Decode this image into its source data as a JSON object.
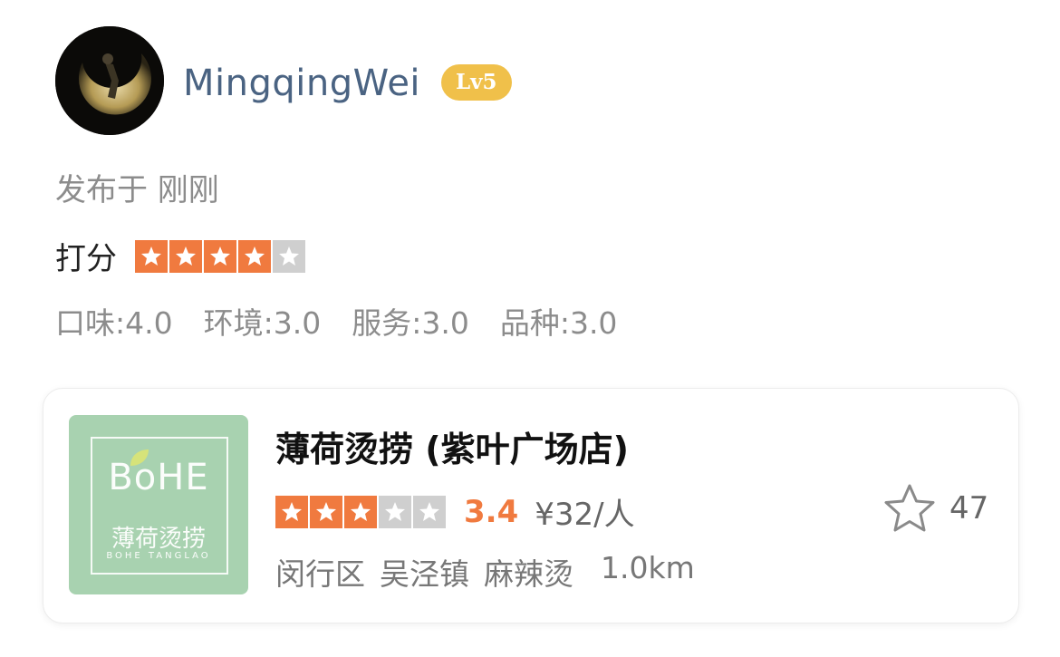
{
  "user": {
    "name": "MingqingWei",
    "level": "Lv5"
  },
  "post": {
    "published": "发布于 刚刚"
  },
  "rating": {
    "label": "打分",
    "stars": 4,
    "max_stars": 5,
    "subscores": [
      {
        "label": "口味:4.0"
      },
      {
        "label": "环境:3.0"
      },
      {
        "label": "服务:3.0"
      },
      {
        "label": "品种:3.0"
      }
    ]
  },
  "shop": {
    "name": "薄荷烫捞 (紫叶广场店)",
    "stars": 3,
    "max_stars": 5,
    "score": "3.4",
    "price": "¥32/人",
    "district": "闵行区",
    "area": "吴泾镇",
    "category": "麻辣烫",
    "distance": "1.0km",
    "favorites": "47",
    "logo": {
      "brand": "BoHE",
      "cn": "薄荷烫捞",
      "en": "BOHE TANGLAO"
    }
  },
  "colors": {
    "accent": "#f07a3f",
    "level_badge": "#f0c04a",
    "username": "#4a6382",
    "logo_bg": "#a8d2b0"
  }
}
